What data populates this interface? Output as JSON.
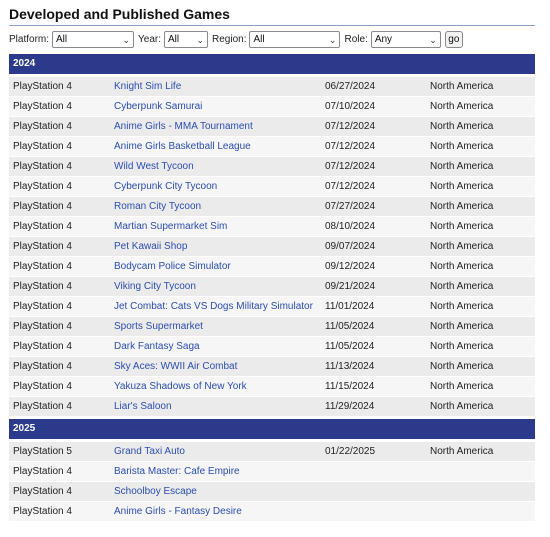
{
  "page": {
    "title": "Developed and Published Games"
  },
  "filters": {
    "platform_label": "Platform:",
    "platform_value": "All",
    "year_label": "Year:",
    "year_value": "All",
    "region_label": "Region:",
    "region_value": "All",
    "role_label": "Role:",
    "role_value": "Any",
    "go_label": "go"
  },
  "groups": [
    {
      "year": "2024",
      "rows": [
        {
          "platform": "PlayStation 4",
          "game": "Knight Sim Life",
          "date": "06/27/2024",
          "region": "North America"
        },
        {
          "platform": "PlayStation 4",
          "game": "Cyberpunk Samurai",
          "date": "07/10/2024",
          "region": "North America"
        },
        {
          "platform": "PlayStation 4",
          "game": "Anime Girls - MMA Tournament",
          "date": "07/12/2024",
          "region": "North America"
        },
        {
          "platform": "PlayStation 4",
          "game": "Anime Girls Basketball League",
          "date": "07/12/2024",
          "region": "North America"
        },
        {
          "platform": "PlayStation 4",
          "game": "Wild West Tycoon",
          "date": "07/12/2024",
          "region": "North America"
        },
        {
          "platform": "PlayStation 4",
          "game": "Cyberpunk City Tycoon",
          "date": "07/12/2024",
          "region": "North America"
        },
        {
          "platform": "PlayStation 4",
          "game": "Roman City Tycoon",
          "date": "07/27/2024",
          "region": "North America"
        },
        {
          "platform": "PlayStation 4",
          "game": "Martian Supermarket Sim",
          "date": "08/10/2024",
          "region": "North America"
        },
        {
          "platform": "PlayStation 4",
          "game": "Pet Kawaii Shop",
          "date": "09/07/2024",
          "region": "North America"
        },
        {
          "platform": "PlayStation 4",
          "game": "Bodycam Police Simulator",
          "date": "09/12/2024",
          "region": "North America"
        },
        {
          "platform": "PlayStation 4",
          "game": "Viking City Tycoon",
          "date": "09/21/2024",
          "region": "North America"
        },
        {
          "platform": "PlayStation 4",
          "game": "Jet Combat: Cats VS Dogs Military Simulator",
          "date": "11/01/2024",
          "region": "North America"
        },
        {
          "platform": "PlayStation 4",
          "game": "Sports Supermarket",
          "date": "11/05/2024",
          "region": "North America"
        },
        {
          "platform": "PlayStation 4",
          "game": "Dark Fantasy Saga",
          "date": "11/05/2024",
          "region": "North America"
        },
        {
          "platform": "PlayStation 4",
          "game": "Sky Aces: WWII Air Combat",
          "date": "11/13/2024",
          "region": "North America"
        },
        {
          "platform": "PlayStation 4",
          "game": "Yakuza Shadows of New York",
          "date": "11/15/2024",
          "region": "North America"
        },
        {
          "platform": "PlayStation 4",
          "game": "Liar's Saloon",
          "date": "11/29/2024",
          "region": "North America"
        }
      ]
    },
    {
      "year": "2025",
      "rows": [
        {
          "platform": "PlayStation 5",
          "game": "Grand Taxi Auto",
          "date": "01/22/2025",
          "region": "North America"
        },
        {
          "platform": "PlayStation 4",
          "game": "Barista Master: Cafe Empire",
          "date": "",
          "region": ""
        },
        {
          "platform": "PlayStation 4",
          "game": "Schoolboy Escape",
          "date": "",
          "region": ""
        },
        {
          "platform": "PlayStation 4",
          "game": "Anime Girls - Fantasy Desire",
          "date": "",
          "region": ""
        }
      ]
    }
  ]
}
